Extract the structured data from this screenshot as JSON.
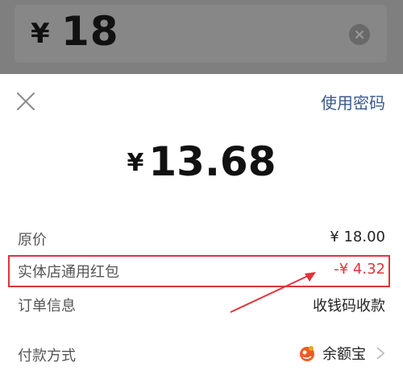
{
  "input": {
    "currency": "¥",
    "value": "18"
  },
  "sheet": {
    "use_password": "使用密码",
    "pay_currency": "¥",
    "pay_amount": "13.68"
  },
  "details": {
    "original_price_label": "原价",
    "original_price_value": "¥ 18.00",
    "discount_label": "实体店通用红包",
    "discount_value": "-¥ 4.32",
    "order_label": "订单信息",
    "order_value": "收钱码收款",
    "method_label": "付款方式",
    "method_value": "余额宝"
  },
  "icons": {
    "clear": "clear-icon",
    "close": "close-icon",
    "method": "yuebao-icon",
    "chevron": "chevron-right-icon"
  },
  "colors": {
    "highlight": "#e3323a",
    "link": "#3a5a8c",
    "discount": "#e3323a"
  }
}
